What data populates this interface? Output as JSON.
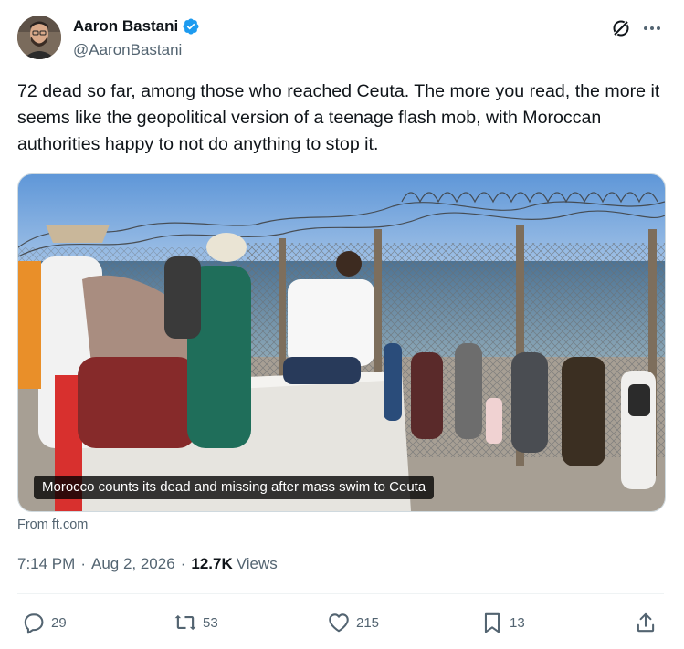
{
  "author": {
    "display_name": "Aaron Bastani",
    "handle": "@AaronBastani",
    "verified": true,
    "avatar_icon": "avatar-photo"
  },
  "header_icons": {
    "grok": "grok-icon",
    "more": "more-icon"
  },
  "tweet": {
    "text": "72 dead so far, among those who reached Ceuta.  The more you read, the more it seems like the geopolitical version of a teenage flash mob, with Moroccan authorities happy to not do anything to stop it."
  },
  "media": {
    "caption": "Morocco counts its dead and missing after mass swim to Ceuta",
    "source": "From ft.com"
  },
  "meta": {
    "time": "7:14 PM",
    "date": "Aug 2, 2026",
    "views_count": "12.7K",
    "views_label": "Views"
  },
  "actions": {
    "reply": "29",
    "retweet": "53",
    "like": "215",
    "bookmark": "13"
  },
  "colors": {
    "text_primary": "#0f1419",
    "text_secondary": "#536471",
    "verified_blue": "#1d9bf0",
    "divider": "#eff3f4"
  }
}
